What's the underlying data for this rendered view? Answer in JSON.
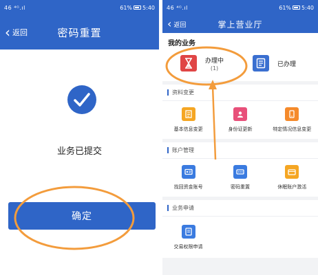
{
  "left_screen": {
    "status_bar": {
      "signal": "46 ⁴ᴳ.ıl",
      "battery": "61%",
      "time": "5:40"
    },
    "header": {
      "back_label": "返回",
      "title": "密码重置"
    },
    "body": {
      "message": "业务已提交",
      "confirm_label": "确定"
    }
  },
  "right_screen": {
    "status_bar": {
      "signal": "46 ⁴ᴳ.ıl",
      "battery": "61%",
      "time": "5:40"
    },
    "header": {
      "back_label": "返回",
      "title": "掌上营业厅"
    },
    "my_business": {
      "heading": "我的业务",
      "in_progress": {
        "label": "办理中",
        "count": "(1)"
      },
      "completed": {
        "label": "已办理"
      }
    },
    "sections": [
      {
        "title": "资料变更",
        "items": [
          {
            "label": "基本信息变更",
            "icon": "document-icon",
            "color": "#f5a623"
          },
          {
            "label": "身份证更新",
            "icon": "id-person-icon",
            "color": "#e8507a"
          },
          {
            "label": "特定情况信息变更",
            "icon": "phone-card-icon",
            "color": "#f58a2b"
          }
        ]
      },
      {
        "title": "账户管理",
        "items": [
          {
            "label": "找回资金账号",
            "icon": "account-card-icon",
            "color": "#3a7be0"
          },
          {
            "label": "密码重置",
            "icon": "password-icon",
            "color": "#3a7be0"
          },
          {
            "label": "休眠账户激活",
            "icon": "wallet-icon",
            "color": "#f5a623"
          }
        ]
      },
      {
        "title": "业务申请",
        "items": [
          {
            "label": "交易权限申请",
            "icon": "permission-icon",
            "color": "#3a7be0"
          }
        ]
      }
    ]
  },
  "annotation": {
    "color": "#f39c3c"
  },
  "colors": {
    "primary": "#2f65c7",
    "annotation": "#f39c3c"
  }
}
